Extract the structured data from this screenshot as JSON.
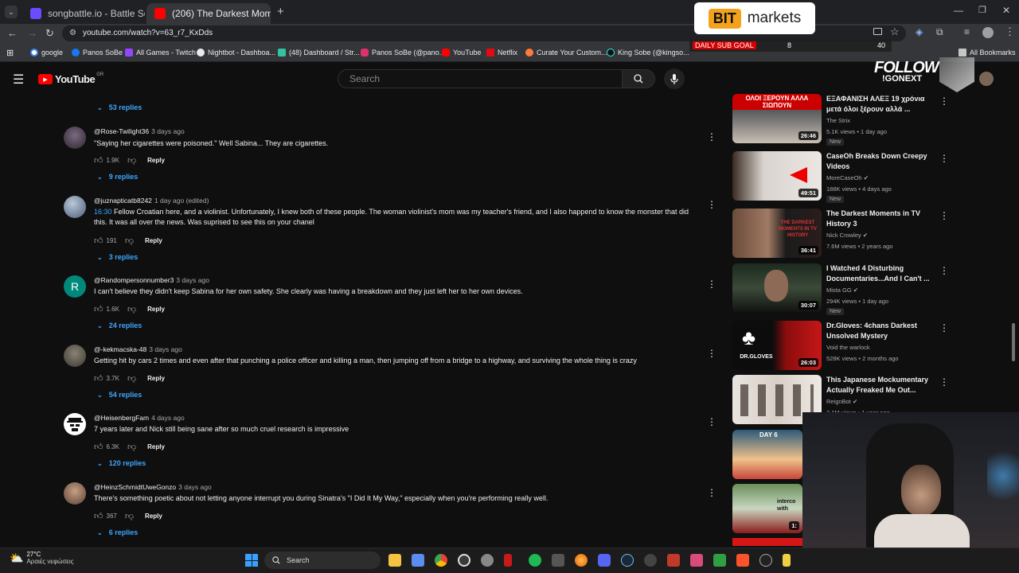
{
  "browser": {
    "tabs": [
      {
        "title": "songbattle.io - Battle Songs ag",
        "active": false
      },
      {
        "title": "(206) The Darkest Moments in",
        "active": true
      }
    ],
    "url": "youtube.com/watch?v=63_r7_KxDds",
    "bookmarks": [
      "google",
      "Panos SoBe",
      "All Games - Twitch",
      "Nightbot - Dashboa...",
      "(48) Dashboard / Str...",
      "Panos SoBe (@pano...",
      "YouTube",
      "Netflix",
      "Curate Your Custom...",
      "King Sobe (@kingso..."
    ],
    "all_bookmarks": "All Bookmarks"
  },
  "overlay": {
    "bit_logo": "BIT",
    "bit_text": "markets",
    "subgoal_label": "DAILY SUB GOAL",
    "subgoal_current": "8",
    "subgoal_target": "40",
    "follow_text": "FOLLOW",
    "follow_handle": "!GONEXT"
  },
  "youtube": {
    "logo": "YouTube",
    "country": "GR",
    "search_placeholder": "Search"
  },
  "top_replies": "53 replies",
  "comments": [
    {
      "author": "@Rose-Twilight36",
      "time": "3 days ago",
      "timestamp": "",
      "text": "\"Saying her cigarettes were poisoned.\" Well Sabina... They are cigarettes.",
      "likes": "1.9K",
      "replies": "9 replies"
    },
    {
      "author": "@juznapticatb8242",
      "time": "1 day ago (edited)",
      "timestamp": "16:30",
      "text": " Fellow Croatian here, and a violinist. Unfortunately, I knew both of these people. The woman violinist's mom was my teacher's friend, and I also happend to know the monster that did this. It was all over the news. Was suprised to see this on your chanel",
      "likes": "191",
      "replies": "3 replies"
    },
    {
      "author": "@Randompersonnumber3",
      "time": "3 days ago",
      "timestamp": "",
      "text": "I can't believe they didn't keep Sabina for her own safety. She clearly was having a breakdown and they just left her to her own devices.",
      "likes": "1.6K",
      "replies": "24 replies"
    },
    {
      "author": "@-kekmacska-48",
      "time": "3 days ago",
      "timestamp": "",
      "text": "Getting hit by cars 2 times and even after that punching a police officer and killing a man, then jumping off from a bridge to a highway, and surviving the whole thing is crazy",
      "likes": "3.7K",
      "replies": "54 replies"
    },
    {
      "author": "@HeisenbergFam",
      "time": "4 days ago",
      "timestamp": "",
      "text": "7 years later and Nick still being sane after so much cruel research is impressive",
      "likes": "6.3K",
      "replies": "120 replies"
    },
    {
      "author": "@HeinzSchmidtUweGonzo",
      "time": "3 days ago",
      "timestamp": "",
      "text": "There's something poetic about not letting anyone interrupt you during Sinatra's \"I Did It My Way,\" especially when you're performing really well.",
      "likes": "367",
      "replies": "6 replies"
    }
  ],
  "reply_label": "Reply",
  "avatar_letter": "R",
  "recommendations": [
    {
      "title": "ΕΞΑΦΑΝΙΣΗ ΑΛΕΞ  19 χρόνια μετά όλοι ξέρουν αλλά ...",
      "channel": "The Strix",
      "meta": "5.1K views • 1 day ago",
      "duration": "26:46",
      "new": "New",
      "thumb_text": "ΟΛΟΙ ΞΕΡΟΥΝ ΑΛΛΑ ΣΙΩΠΟΥΝ",
      "verified": false
    },
    {
      "title": "CaseOh Breaks Down Creepy Videos",
      "channel": "MoreCaseOh",
      "meta": "188K views • 4 days ago",
      "duration": "49:51",
      "new": "New",
      "thumb_text": "",
      "verified": true
    },
    {
      "title": "The Darkest Moments in TV History 3",
      "channel": "Nick Crowley",
      "meta": "7.6M views • 2 years ago",
      "duration": "36:41",
      "new": "",
      "thumb_text": "THE DARKEST MOMENTS IN TV HISTORY",
      "verified": true
    },
    {
      "title": "I Watched 4 Disturbing Documentaries...And I Can't ...",
      "channel": "Mista GG",
      "meta": "294K views • 1 day ago",
      "duration": "30:07",
      "new": "New",
      "thumb_text": "",
      "verified": true
    },
    {
      "title": "Dr.Gloves: 4chans Darkest Unsolved Mystery",
      "channel": "Void the warlock",
      "meta": "528K views • 2 months ago",
      "duration": "26:03",
      "new": "",
      "thumb_text": "DR.GLOVES",
      "verified": false
    },
    {
      "title": "This Japanese Mockumentary Actually Freaked Me Out...",
      "channel": "ReignBot",
      "meta": "3.1M views • 1 year ago",
      "duration": "",
      "new": "",
      "thumb_text": "",
      "verified": true
    },
    {
      "title": "",
      "channel": "",
      "meta": "",
      "duration": "",
      "new": "",
      "thumb_text": "DAY 6",
      "verified": false
    },
    {
      "title": "",
      "channel": "",
      "meta": "",
      "duration": "1:",
      "new": "",
      "thumb_text": "interco with",
      "verified": false
    }
  ],
  "taskbar": {
    "weather_temp": "27°C",
    "weather_desc": "Αραιές νεφώσεις",
    "search_label": "Search"
  }
}
